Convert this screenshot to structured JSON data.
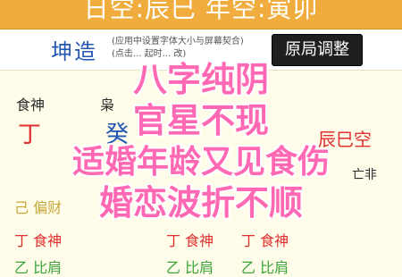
{
  "topbar": {
    "title": "日空:辰巳 年空:寅卯"
  },
  "header": {
    "title": "坤造",
    "note_line1": "(应用中设置字体大小与屏幕契合)",
    "note_line2": "(点击... 起时... 改)",
    "adjust_button": "原局调整"
  },
  "chart": {
    "row1": [
      "食神",
      "枭"
    ],
    "row2_left": "丁",
    "row2_mid": "癸",
    "void_label": "辰巳空",
    "row3_right": "亡非",
    "hidden_rows": [
      {
        "stem": "己",
        "god": "偏财"
      },
      {
        "stem": "丁",
        "god": "食神"
      },
      {
        "stem": "乙",
        "god": "比肩"
      }
    ],
    "hidden_mid": [
      {
        "stem": "丁",
        "god": "食神"
      },
      {
        "stem": "乙",
        "god": "比肩"
      }
    ],
    "hidden_right": [
      {
        "stem": "丁",
        "god": "食神"
      },
      {
        "stem": "乙",
        "god": "比肩"
      }
    ]
  },
  "overlay": {
    "line1": "八字纯阴",
    "line2": "官星不现",
    "line3": "适婚年龄又见食伤",
    "line4": "婚恋波折不顺"
  },
  "colors": {
    "topbar_bg": "#f0ad3e",
    "overlay_text": "#ff69b4",
    "accent_blue": "#2457b4",
    "red": "#e02f2f",
    "green": "#3aa33a"
  }
}
